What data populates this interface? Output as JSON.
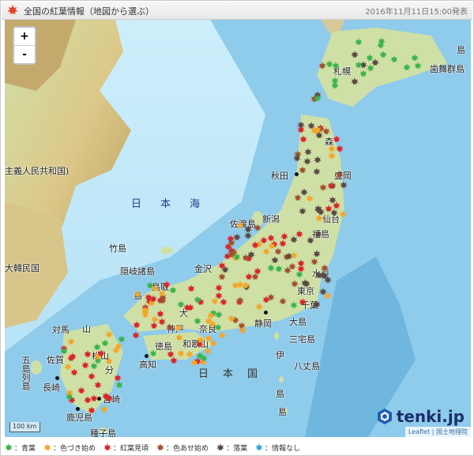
{
  "header": {
    "title": "全国の紅葉情報（地図から選ぶ）",
    "timestamp": "2016年11月11日15:00発表"
  },
  "map": {
    "zoom_in": "+",
    "zoom_out": "-",
    "scale_label": "100 km",
    "attribution": "Leaflet | 国土地理院",
    "brand": "tenki.jp",
    "sea_label": "日本海",
    "country_label": "日本国",
    "regions": {
      "korea_north": "主義人民共和国)",
      "korea_south": "大韓民国",
      "habomai": "歯舞群島",
      "kunashiri": "色丹島",
      "sado": "佐渡島",
      "oki": "隠岐諸島",
      "takeshima": "竹島",
      "tsushima": "対馬",
      "goto": "五島列島",
      "oshima": "大島",
      "miyake": "三宅島",
      "hachijo": "八丈島",
      "izu": "伊",
      "tanegashima": "種子島",
      "island_small": "島"
    },
    "cities": {
      "sapporo": "札幌",
      "aomori": "森",
      "akita": "秋田",
      "morioka": "盛岡",
      "sendai": "仙台",
      "niigata": "新潟",
      "fukushima": "福島",
      "kanazawa": "金沢",
      "mito": "水戸",
      "tokyo": "東京",
      "chiba": "千葉",
      "shizuoka": "静岡",
      "osaka": "大",
      "kobe": "神戸",
      "nara": "奈良",
      "wakayama": "和歌山",
      "tottori": "鳥取",
      "matsue": "島",
      "hiroshima": "山",
      "matsuyama": "松山",
      "kochi": "高知",
      "tokushima": "徳島",
      "fukuoka": "福岡",
      "saga": "佐賀",
      "nagasaki": "長崎",
      "oita": "分",
      "miyazaki": "宮崎",
      "kagoshima": "鹿児島",
      "kumamoto": "熊"
    }
  },
  "legend": [
    {
      "label": "：青葉",
      "color": "#3bb44a"
    },
    {
      "label": "：色づき始め",
      "color": "#f4a62a"
    },
    {
      "label": "：紅葉見頃",
      "color": "#d8262c"
    },
    {
      "label": "：色あせ始め",
      "color": "#a0522d"
    },
    {
      "label": "：落葉",
      "color": "#5a4a42"
    },
    {
      "label": "：情報なし",
      "color": "#3aa6d8"
    }
  ]
}
